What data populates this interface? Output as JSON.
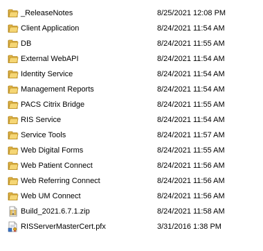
{
  "files": [
    {
      "name": "_ReleaseNotes",
      "modified": "8/25/2021 12:08 PM",
      "icon": "folder-icon"
    },
    {
      "name": "Client Application",
      "modified": "8/24/2021 11:54 AM",
      "icon": "folder-icon"
    },
    {
      "name": "DB",
      "modified": "8/24/2021 11:55 AM",
      "icon": "folder-icon"
    },
    {
      "name": "External WebAPI",
      "modified": "8/24/2021 11:54 AM",
      "icon": "folder-icon"
    },
    {
      "name": "Identity Service",
      "modified": "8/24/2021 11:54 AM",
      "icon": "folder-icon"
    },
    {
      "name": "Management Reports",
      "modified": "8/24/2021 11:54 AM",
      "icon": "folder-icon"
    },
    {
      "name": "PACS Citrix Bridge",
      "modified": "8/24/2021 11:55 AM",
      "icon": "folder-icon"
    },
    {
      "name": "RIS Service",
      "modified": "8/24/2021 11:54 AM",
      "icon": "folder-icon"
    },
    {
      "name": "Service Tools",
      "modified": "8/24/2021 11:57 AM",
      "icon": "folder-icon"
    },
    {
      "name": "Web Digital Forms",
      "modified": "8/24/2021 11:55 AM",
      "icon": "folder-icon"
    },
    {
      "name": "Web Patient Connect",
      "modified": "8/24/2021 11:56 AM",
      "icon": "folder-icon"
    },
    {
      "name": "Web Referring Connect",
      "modified": "8/24/2021 11:56 AM",
      "icon": "folder-icon"
    },
    {
      "name": "Web UM Connect",
      "modified": "8/24/2021 11:56 AM",
      "icon": "folder-icon"
    },
    {
      "name": "Build_2021.6.7.1.zip",
      "modified": "8/24/2021 11:58 AM",
      "icon": "zip-file-icon"
    },
    {
      "name": "RISServerMasterCert.pfx",
      "modified": "3/31/2016 1:38 PM",
      "icon": "certificate-file-icon"
    }
  ],
  "colors": {
    "folder_front": "#f5d675",
    "folder_back": "#e0b446",
    "folder_edge": "#b88a1e"
  }
}
